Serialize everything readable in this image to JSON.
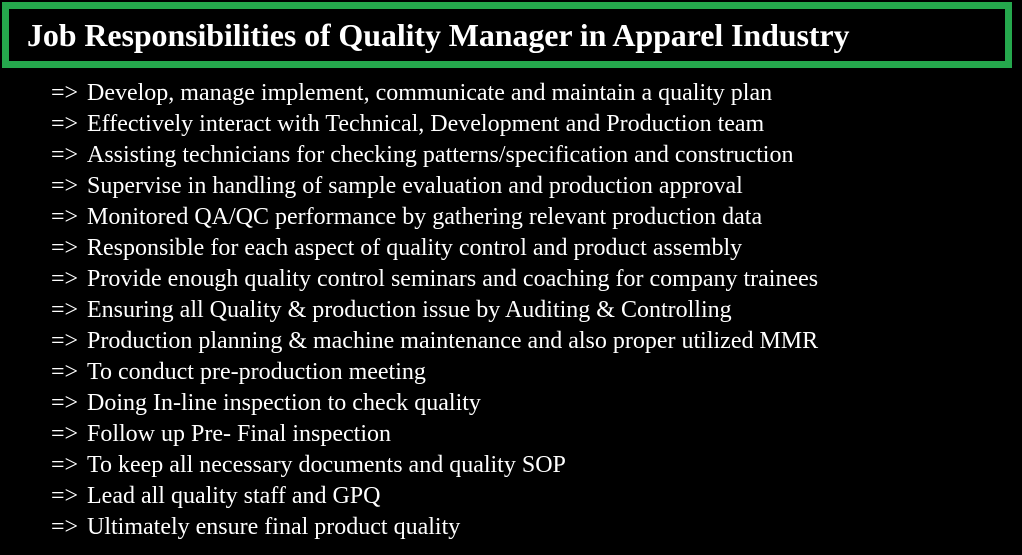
{
  "slide": {
    "background_color": "#000000",
    "text_color": "#ffffff"
  },
  "header": {
    "title": "Job Responsibilities of Quality Manager in Apparel Industry",
    "border_color": "#25a84d",
    "background_color": "#000000"
  },
  "list": {
    "marker": "=>",
    "items": [
      {
        "text": "Develop, manage implement, communicate and maintain a quality plan"
      },
      {
        "text": "Effectively interact with Technical, Development and Production team"
      },
      {
        "text": "Assisting technicians for checking patterns/specification and construction"
      },
      {
        "text": "Supervise in handling of sample evaluation and production approval"
      },
      {
        "text": "Monitored QA/QC performance by gathering relevant production data"
      },
      {
        "text": "Responsible for each aspect of quality control and product assembly"
      },
      {
        "text": "Provide enough quality control seminars and coaching for company trainees"
      },
      {
        "text": "Ensuring all Quality & production issue by Auditing & Controlling"
      },
      {
        "text": "Production planning & machine maintenance and also proper utilized MMR"
      },
      {
        "text": "To conduct pre-production meeting"
      },
      {
        "text": "Doing In-line inspection to check quality"
      },
      {
        "text": "Follow up Pre- Final inspection"
      },
      {
        "text": "To keep all necessary documents and quality SOP"
      },
      {
        "text": "Lead all quality staff and GPQ"
      },
      {
        "text": "Ultimately ensure final product quality"
      }
    ]
  }
}
